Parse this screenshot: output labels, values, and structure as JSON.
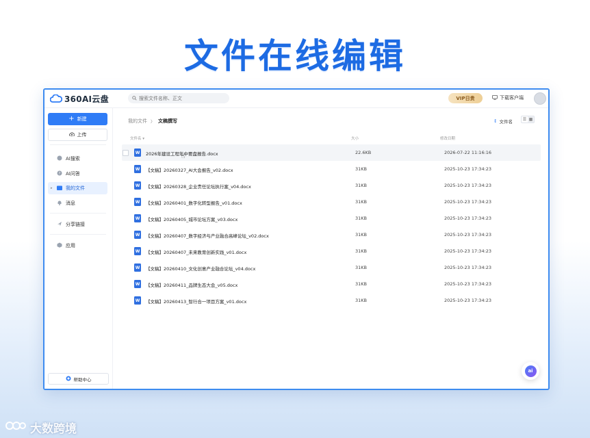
{
  "headline": "文件在线编辑",
  "app": {
    "logo_text": "360AI云盘"
  },
  "topbar": {
    "search_placeholder": "搜索文件名称、正文",
    "vip_label": "VIP日贵",
    "client_label": "下载客户端"
  },
  "sidebar": {
    "new_label": "新建",
    "upload_label": "上传",
    "items": [
      {
        "label": "AI搜索",
        "icon": "ai-search-icon"
      },
      {
        "label": "AI问答",
        "icon": "question-icon"
      },
      {
        "label": "我的文件",
        "icon": "folder-icon",
        "active": true
      },
      {
        "label": "消息",
        "icon": "bell-icon"
      },
      {
        "label": "分享链接",
        "icon": "share-icon"
      },
      {
        "label": "应用",
        "icon": "app-icon"
      }
    ],
    "help_label": "帮助中心"
  },
  "main": {
    "breadcrumb": {
      "root": "我的文件",
      "separator": "〉",
      "current": "文稿撰写"
    },
    "sort_label": "文件名",
    "columns": {
      "name": "文件名 ▾",
      "size": "大小",
      "date": "修改日期"
    },
    "files": [
      {
        "name": "2026年建设工程年中要盘报告.docx",
        "size": "22.6KB",
        "date": "2026-07-22 11:16:16"
      },
      {
        "name": "【文稿】20260327_AI大会报告_v02.docx",
        "size": "31KB",
        "date": "2025-10-23 17:34:23"
      },
      {
        "name": "【文稿】20260328_企业责任论坛执行案_v04.docx",
        "size": "31KB",
        "date": "2025-10-23 17:34:23"
      },
      {
        "name": "【文稿】20260401_数字化转型报告_v01.docx",
        "size": "31KB",
        "date": "2025-10-23 17:34:23"
      },
      {
        "name": "【文稿】20260405_城市论坛方案_v03.docx",
        "size": "31KB",
        "date": "2025-10-23 17:34:23"
      },
      {
        "name": "【文稿】20260407_数字经济与产业融合高峰论坛_v02.docx",
        "size": "31KB",
        "date": "2025-10-23 17:34:23"
      },
      {
        "name": "【文稿】20260407_未来教育创新实践_v01.docx",
        "size": "31KB",
        "date": "2025-10-23 17:34:23"
      },
      {
        "name": "【文稿】20260410_文化创意产业融合论坛_v04.docx",
        "size": "31KB",
        "date": "2025-10-23 17:34:23"
      },
      {
        "name": "【文稿】20260411_品牌生态大会_v05.docx",
        "size": "31KB",
        "date": "2025-10-23 17:34:23"
      },
      {
        "name": "【文稿】20260413_智行合一项目方案_v01.docx",
        "size": "31KB",
        "date": "2025-10-23 17:34:23"
      }
    ],
    "ai_button_label": "ai"
  },
  "watermark": "大数跨境",
  "colors": {
    "accent": "#2f7cf6",
    "headline": "#1d6be3",
    "word": "#2f6fe0"
  }
}
